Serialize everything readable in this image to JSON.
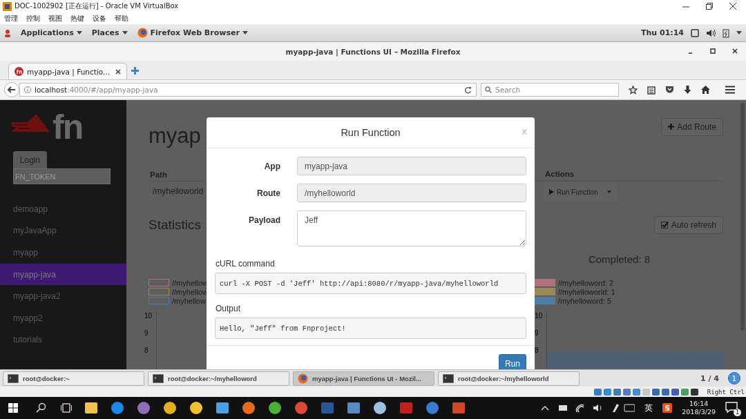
{
  "vbox_window": {
    "title": "DOC-1002902 [正在运行] - Oracle VM VirtualBox",
    "menu": [
      "管理",
      "控制",
      "视图",
      "热键",
      "设备",
      "帮助"
    ]
  },
  "gnome_top_bar": {
    "menus": [
      "Applications",
      "Places",
      "Firefox Web Browser"
    ],
    "clock": "Thu 01:14"
  },
  "firefox": {
    "title": "myapp-java | Functions UI – Mozilla Firefox",
    "tabs": [
      {
        "label": "myapp-java | Functio...",
        "selected": true
      }
    ],
    "url_host": "localhost",
    "url_path": ":4000/#/app/myapp-java",
    "search_placeholder": "Search"
  },
  "sidebar": {
    "logo": "fn",
    "login": "Login",
    "token_placeholder": "FN_TOKEN",
    "apps": [
      {
        "label": "demoapp",
        "selected": false
      },
      {
        "label": "myJavaApp",
        "selected": false
      },
      {
        "label": "myapp",
        "selected": false
      },
      {
        "label": "myapp-java",
        "selected": true
      },
      {
        "label": "myapp-java2",
        "selected": false
      },
      {
        "label": "myapp2",
        "selected": false
      },
      {
        "label": "tutorials",
        "selected": false
      }
    ]
  },
  "page": {
    "title": "myap",
    "add_route": "Add Route",
    "columns": [
      "Path",
      "Actions"
    ],
    "rows": [
      {
        "path": "/myhelloworld",
        "action": "Run Function"
      }
    ],
    "statistics": "Statistics",
    "auto_refresh": {
      "label": "Auto refresh",
      "checked": true
    },
    "left_legend": [
      {
        "label": "//myhellow",
        "color": "#b0707c"
      },
      {
        "label": "//myhellow",
        "color": "#9a8a5a"
      },
      {
        "label": "/myhellow",
        "color": "#4f7ea4"
      }
    ],
    "left_ticks": [
      "10",
      "9",
      "8"
    ],
    "completed": "Completed: 8",
    "right_legend": [
      {
        "label": "//myhelloword: 2",
        "color": "#b0707c"
      },
      {
        "label": "//myhelloworld: 1",
        "color": "#9a8a5a"
      },
      {
        "label": "/myhelloword: 5",
        "color": "#4f7ea4"
      }
    ],
    "right_ticks": [
      "10",
      "9",
      "8"
    ]
  },
  "dialog": {
    "title": "Run Function",
    "close": "x",
    "fields": [
      {
        "label": "App",
        "value": "myapp-java",
        "kind": "input"
      },
      {
        "label": "Route",
        "value": "/myhelloworld",
        "kind": "input"
      },
      {
        "label": "Payload",
        "value": "Jeff",
        "kind": "textarea"
      }
    ],
    "curl_label": "cURL command",
    "curl": "curl -X POST -d 'Jeff' http://api:8080/r/myapp-java/myhelloworld",
    "output_label": "Output",
    "output": "Hello, \"Jeff\" from Fnproject!",
    "run": "Run"
  },
  "gnome_taskbar": {
    "windows": [
      {
        "label": "root@docker:~",
        "kind": "terminal",
        "selected": false
      },
      {
        "label": "root@docker:~/myhelloword",
        "kind": "terminal",
        "selected": false
      },
      {
        "label": "myapp-java | Functions UI - Mozil...",
        "kind": "browser",
        "selected": true
      },
      {
        "label": "root@docker:~/myhelloworld",
        "kind": "terminal",
        "selected": false
      }
    ],
    "workspace": "1 / 4",
    "workspace_badge": "1"
  },
  "vbox_status": {
    "host_key": "Right Ctrl"
  },
  "windows_taskbar": {
    "apps": [
      {
        "kind": "square",
        "color": "#f2c14e"
      },
      {
        "kind": "round",
        "color": "#1e88e5"
      },
      {
        "kind": "round",
        "color": "#8e6fb5"
      },
      {
        "kind": "round",
        "color": "#e0b020"
      },
      {
        "kind": "round",
        "color": "#f0c030"
      },
      {
        "kind": "square",
        "color": "#4aa0e0"
      },
      {
        "kind": "round",
        "color": "#e66a1f"
      },
      {
        "kind": "round",
        "color": "#4ab03a"
      },
      {
        "kind": "round",
        "color": "#d94a3a"
      },
      {
        "kind": "square",
        "color": "#2b5797"
      },
      {
        "kind": "square",
        "color": "#5a8ac0"
      },
      {
        "kind": "round",
        "color": "#a0c0e0"
      },
      {
        "kind": "square",
        "color": "#c02020"
      },
      {
        "kind": "round",
        "color": "#3a7ad0"
      },
      {
        "kind": "square",
        "color": "#d24726"
      }
    ],
    "language": "英",
    "time": "16:14",
    "date": "2018/3/29",
    "notifications": "1"
  }
}
